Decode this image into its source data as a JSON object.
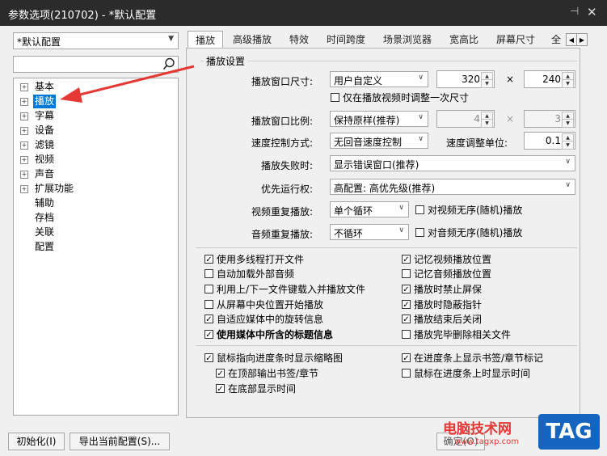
{
  "window": {
    "title": "参数选项(210702) - *默认配置",
    "pin_icon": "pin-icon",
    "close_icon": "close-icon"
  },
  "profile": {
    "value": "*默认配置"
  },
  "tree": {
    "items": [
      {
        "label": "基本",
        "expandable": true
      },
      {
        "label": "播放",
        "expandable": true,
        "selected": true
      },
      {
        "label": "字幕",
        "expandable": true
      },
      {
        "label": "设备",
        "expandable": true
      },
      {
        "label": "滤镜",
        "expandable": true
      },
      {
        "label": "视频",
        "expandable": true
      },
      {
        "label": "声音",
        "expandable": true
      },
      {
        "label": "扩展功能",
        "expandable": true
      },
      {
        "label": "辅助",
        "expandable": false
      },
      {
        "label": "存档",
        "expandable": false
      },
      {
        "label": "关联",
        "expandable": false
      },
      {
        "label": "配置",
        "expandable": false
      }
    ]
  },
  "tabs": [
    "播放",
    "高级播放",
    "特效",
    "时间跨度",
    "场景浏览器",
    "宽高比",
    "屏幕尺寸",
    "全"
  ],
  "group": {
    "title": "播放设置",
    "window_size": {
      "label": "播放窗口尺寸:",
      "mode": "用户自定义",
      "width": "320",
      "times": "×",
      "height": "240"
    },
    "adjust_once": "仅在播放视频时调整一次尺寸",
    "ratio": {
      "label": "播放窗口比例:",
      "mode": "保持原样(推荐)",
      "a": "4",
      "times": "×",
      "b": "3"
    },
    "speed": {
      "label": "速度控制方式:",
      "mode": "无回音速度控制",
      "unit_label": "速度调整单位:",
      "unit": "0.1"
    },
    "fail": {
      "label": "播放失败时:",
      "value": "显示错误窗口(推荐)"
    },
    "priority": {
      "label": "优先运行权:",
      "value": "高配置: 高优先级(推荐)"
    },
    "video_repeat": {
      "label": "视频重复播放:",
      "value": "单个循环",
      "random": "对视频无序(随机)播放"
    },
    "audio_repeat": {
      "label": "音频重复播放:",
      "value": "不循环",
      "random": "对音频无序(随机)播放"
    }
  },
  "options_left": [
    {
      "label": "使用多线程打开文件",
      "checked": true
    },
    {
      "label": "自动加载外部音频",
      "checked": false
    },
    {
      "label": "利用上/下一文件键载入并播放文件",
      "checked": false
    },
    {
      "label": "从屏幕中央位置开始播放",
      "checked": false
    },
    {
      "label": "自适应媒体中的旋转信息",
      "checked": true
    },
    {
      "label": "使用媒体中所含的标题信息",
      "checked": true,
      "bold": true
    }
  ],
  "options_right": [
    {
      "label": "记忆视频播放位置",
      "checked": true
    },
    {
      "label": "记忆音频播放位置",
      "checked": false
    },
    {
      "label": "播放时禁止屏保",
      "checked": true
    },
    {
      "label": "播放时隐蔽指针",
      "checked": true
    },
    {
      "label": "播放结束后关闭",
      "checked": true
    },
    {
      "label": "播放完毕删除相关文件",
      "checked": false
    }
  ],
  "thumb": {
    "main": "鼠标指向进度条时显示缩略图",
    "top": "在顶部输出书签/章节",
    "bottom": "在底部显示时间",
    "bookmark": "在进度条上显示书签/章节标记",
    "hover_time": "鼠标在进度条上时显示时间"
  },
  "footer": {
    "init": "初始化(I)",
    "export": "导出当前配置(S)...",
    "ok": "确定(O)"
  },
  "watermark": {
    "text": "电脑技术网",
    "url": "www.tagxp.com",
    "badge": "TAG"
  },
  "annotation_color": "#e53935"
}
